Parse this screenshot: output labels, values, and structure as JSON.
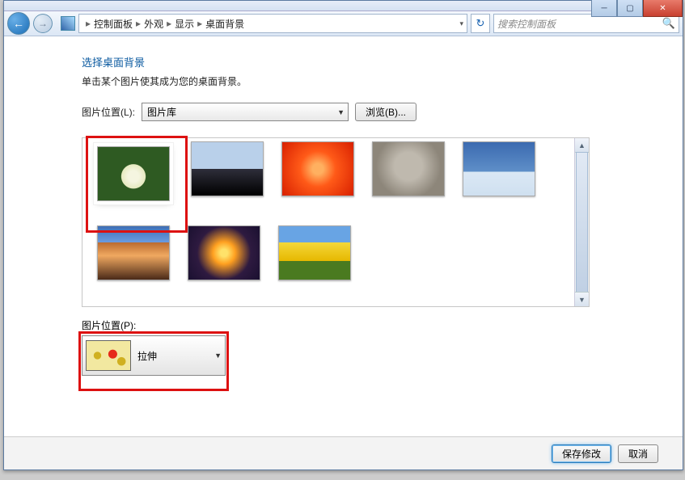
{
  "breadcrumbs": [
    "控制面板",
    "外观",
    "显示",
    "桌面背景"
  ],
  "search": {
    "placeholder": "搜索控制面板"
  },
  "page": {
    "title": "选择桌面背景",
    "desc": "单击某个图片使其成为您的桌面背景。"
  },
  "location": {
    "label": "图片位置(L):",
    "value": "图片库",
    "browse": "浏览(B)..."
  },
  "fit": {
    "label": "图片位置(P):",
    "value": "拉伸"
  },
  "footer": {
    "save": "保存修改",
    "cancel": "取消"
  }
}
